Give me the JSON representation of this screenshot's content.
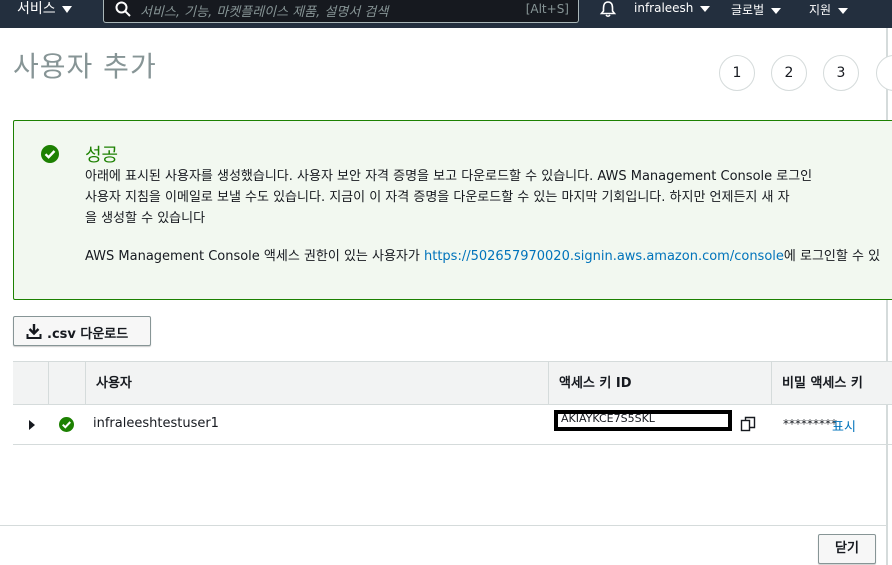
{
  "topbar": {
    "services_label": "서비스",
    "search_placeholder": "서비스, 기능, 마켓플레이스 제품, 설명서 검색",
    "search_shortcut": "[Alt+S]",
    "user": "infraleesh",
    "region": "글로벌",
    "support": "지원"
  },
  "page": {
    "title": "사용자 추가",
    "steps": [
      "1",
      "2",
      "3"
    ]
  },
  "alert": {
    "title": "성공",
    "body_line1": "아래에 표시된 사용자를 생성했습니다. 사용자 보안 자격 증명을 보고 다운로드할 수 있습니다. AWS Management Console 로그인",
    "body_line2": "사용자 지침을 이메일로 보낼 수도 있습니다. 지금이 이 자격 증명을 다운로드할 수 있는 마지막 기회입니다. 하지만 언제든지 새 자",
    "body_line3": "을 생성할 수 있습니다",
    "console_prefix": "AWS Management Console 액세스 권한이 있는 사용자가 ",
    "console_link": "https://502657970020.signin.aws.amazon.com/console",
    "console_suffix": "에 로그인할 수 있"
  },
  "download_button": ".csv 다운로드",
  "table": {
    "headers": [
      "사용자",
      "액세스 키 ID",
      "비밀 액세스 키"
    ],
    "row": {
      "user": "infraleeshtestuser1",
      "access_key_partial": "AKIAYKCE7S5SKL",
      "secret_masked": "*********",
      "show_label": "표시"
    }
  },
  "close_button": "닫기",
  "colors": {
    "topbar_bg": "#232f3e",
    "success_green": "#1d8102",
    "link_blue": "#0073bb"
  }
}
